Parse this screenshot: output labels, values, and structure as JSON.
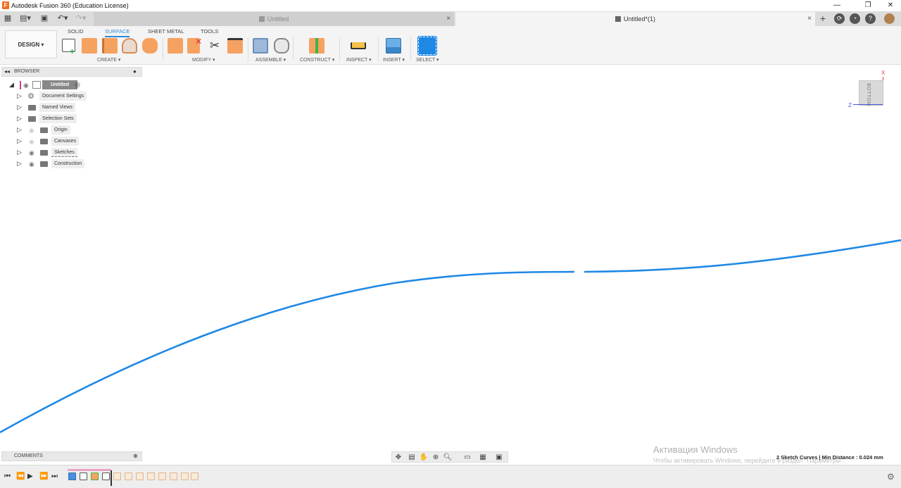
{
  "window": {
    "logo_letter": "F",
    "title": "Autodesk Fusion 360 (Education License)",
    "minimize": "—",
    "restore": "❐",
    "close": "✕"
  },
  "tabs": [
    {
      "label": "Untitled",
      "active": false
    },
    {
      "label": "Untitled*(1)",
      "active": true
    }
  ],
  "tab_close": "×",
  "new_tab": "+",
  "toolbar": {
    "workspace_button": "DESIGN ▾",
    "workspace_tabs": [
      "SOLID",
      "SURFACE",
      "SHEET METAL",
      "TOOLS"
    ],
    "active_workspace_tab": "SURFACE",
    "groups": [
      "CREATE ▾",
      "MODIFY ▾",
      "ASSEMBLE ▾",
      "CONSTRUCT ▾",
      "INSPECT ▾",
      "INSERT ▾",
      "SELECT ▾"
    ]
  },
  "browser": {
    "title": "BROWSER",
    "root": "Untitled",
    "nodes": [
      "Document Settings",
      "Named Views",
      "Selection Sets",
      "Origin",
      "Canvases",
      "Sketches",
      "Construction"
    ]
  },
  "viewcube": {
    "face": "BOTTOM",
    "axis_x": "X",
    "axis_z": "Z"
  },
  "comments": {
    "title": "COMMENTS"
  },
  "status": "2 Sketch Curves | Min Distance : 0.024 mm",
  "activation": {
    "line1": "Активация Windows",
    "line2": "Чтобы активировать Windows, перейдите в раздел \"Параметры\"."
  },
  "colors": {
    "accent": "#2f8ad8",
    "curve": "#1e88e5",
    "orange_tool": "#f5a261",
    "brand": "#f26e21"
  }
}
